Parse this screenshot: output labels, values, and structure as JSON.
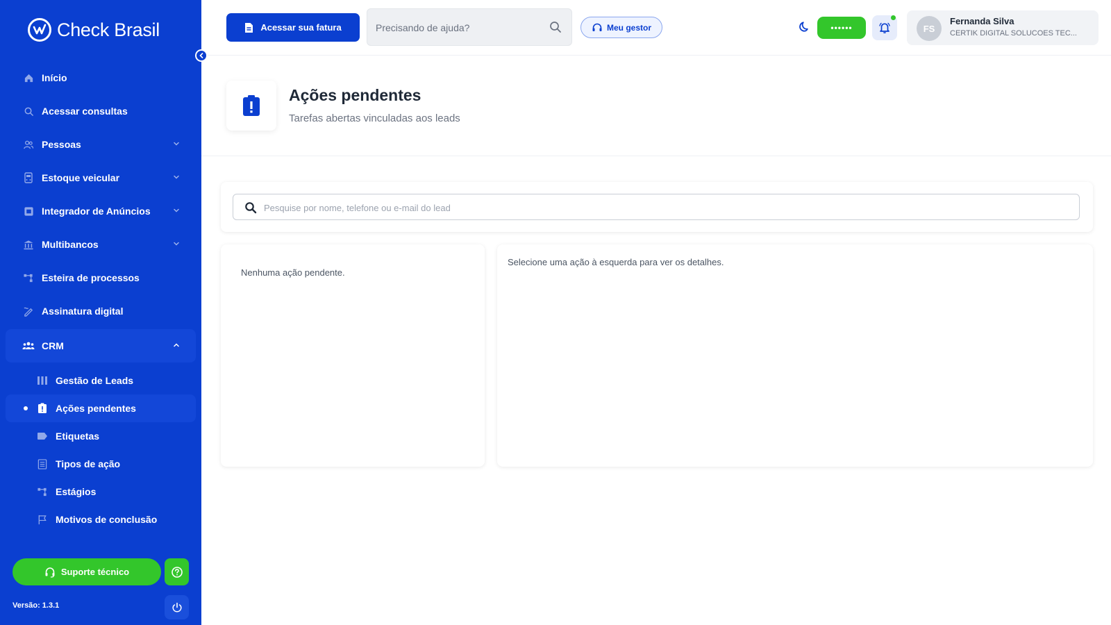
{
  "brand": {
    "name": "Check Brasil"
  },
  "sidebar": {
    "items": [
      {
        "label": "Início",
        "icon": "home-icon"
      },
      {
        "label": "Acessar consultas",
        "icon": "search-icon"
      },
      {
        "label": "Pessoas",
        "icon": "people-icon",
        "expandable": true
      },
      {
        "label": "Estoque veicular",
        "icon": "vehicle-icon",
        "expandable": true
      },
      {
        "label": "Integrador de Anúncios",
        "icon": "ads-icon",
        "expandable": true
      },
      {
        "label": "Multibancos",
        "icon": "bank-icon",
        "expandable": true
      },
      {
        "label": "Esteira de processos",
        "icon": "flow-icon"
      },
      {
        "label": "Assinatura digital",
        "icon": "signature-icon"
      },
      {
        "label": "CRM",
        "icon": "team-icon",
        "expanded": true
      }
    ],
    "crm_subitems": [
      {
        "label": "Gestão de Leads",
        "icon": "kanban-icon"
      },
      {
        "label": "Ações pendentes",
        "icon": "clipboard-alert-icon",
        "active": true
      },
      {
        "label": "Etiquetas",
        "icon": "tag-icon"
      },
      {
        "label": "Tipos de ação",
        "icon": "list-icon"
      },
      {
        "label": "Estágios",
        "icon": "stages-icon"
      },
      {
        "label": "Motivos de conclusão",
        "icon": "flag-icon"
      }
    ],
    "support_label": "Suporte técnico",
    "version": "Versão: 1.3.1"
  },
  "topbar": {
    "invoice_label": "Acessar sua fatura",
    "help_placeholder": "Precisando de ajuda?",
    "manager_label": "Meu gestor",
    "balance_masked": "••••••",
    "user": {
      "initials": "FS",
      "name": "Fernanda Silva",
      "company": "CERTIK DIGITAL SOLUCOES TEC..."
    }
  },
  "page": {
    "title": "Ações pendentes",
    "subtitle": "Tarefas abertas vinculadas aos leads"
  },
  "lead_search": {
    "placeholder": "Pesquise por nome, telefone ou e-mail do lead"
  },
  "panels": {
    "empty_list": "Nenhuma ação pendente.",
    "detail_hint": "Selecione uma ação à esquerda para ver os detalhes."
  },
  "colors": {
    "primary": "#0b3fd0",
    "accent_green": "#33c62b",
    "sidebar_active": "#1347d8"
  }
}
